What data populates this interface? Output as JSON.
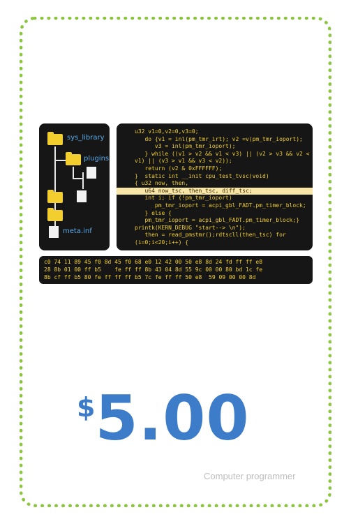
{
  "tree": {
    "labels": [
      "sys_library",
      "plugins",
      "meta.inf"
    ]
  },
  "code": [
    "u32 v1=0,v2=0,v3=0;",
    "   do {v1 = inl(pm_tmr_irt); v2 =v(pm_tmr_ioport);",
    "      v3 = inl(pm_tmr_ioport);",
    "   } while ((v1 > v2 && v1 < v3) || (v2 > v3 && v2 <",
    "v1) || (v3 > v1 && v3 < v2));",
    "   return (v2 & 0xFFFFFF);",
    "}  static int __init cpu_test_tvsc(void)",
    "{ u32 now, then,",
    "   u64 now_tsc, then_tsc, diff_tsc;",
    "   int i; if (!pm_tmr_ioport)",
    "      pm_tmr_ioport = acpi_gbl_FADT.pm_timer_block;",
    "   } else {",
    "   pm_tmr_ioport = acpi_gbl_FADT.pm_timer_block;}",
    "printk(KERN_DEBUG \"start--> \\n\");",
    "   then = read_pmstmr();rdtscll(then_tsc) for",
    "(i=0;i<20;i++) {"
  ],
  "hex": [
    "c0 74 11 89 45 f0 8d 45 f0 68 e0 12 42 00 50 e8 8d 24 fd ff ff e8",
    "28 8b 01 00 ff b5    fe ff ff 8b 43 04 8d 55 9c 00 00 80 bd 1c fe",
    "8b cf ff b5 80 fe ff ff ff b5 7c fe ff ff 50 e8  59 09 00 00 8d"
  ],
  "price": {
    "currency": "$",
    "amount": "5.00"
  },
  "subtitle": "Computer programmer",
  "colors": {
    "border": "#8cc63f",
    "price": "#3d7cc9",
    "code_text": "#f2cf2f",
    "panel_bg": "#161616"
  }
}
